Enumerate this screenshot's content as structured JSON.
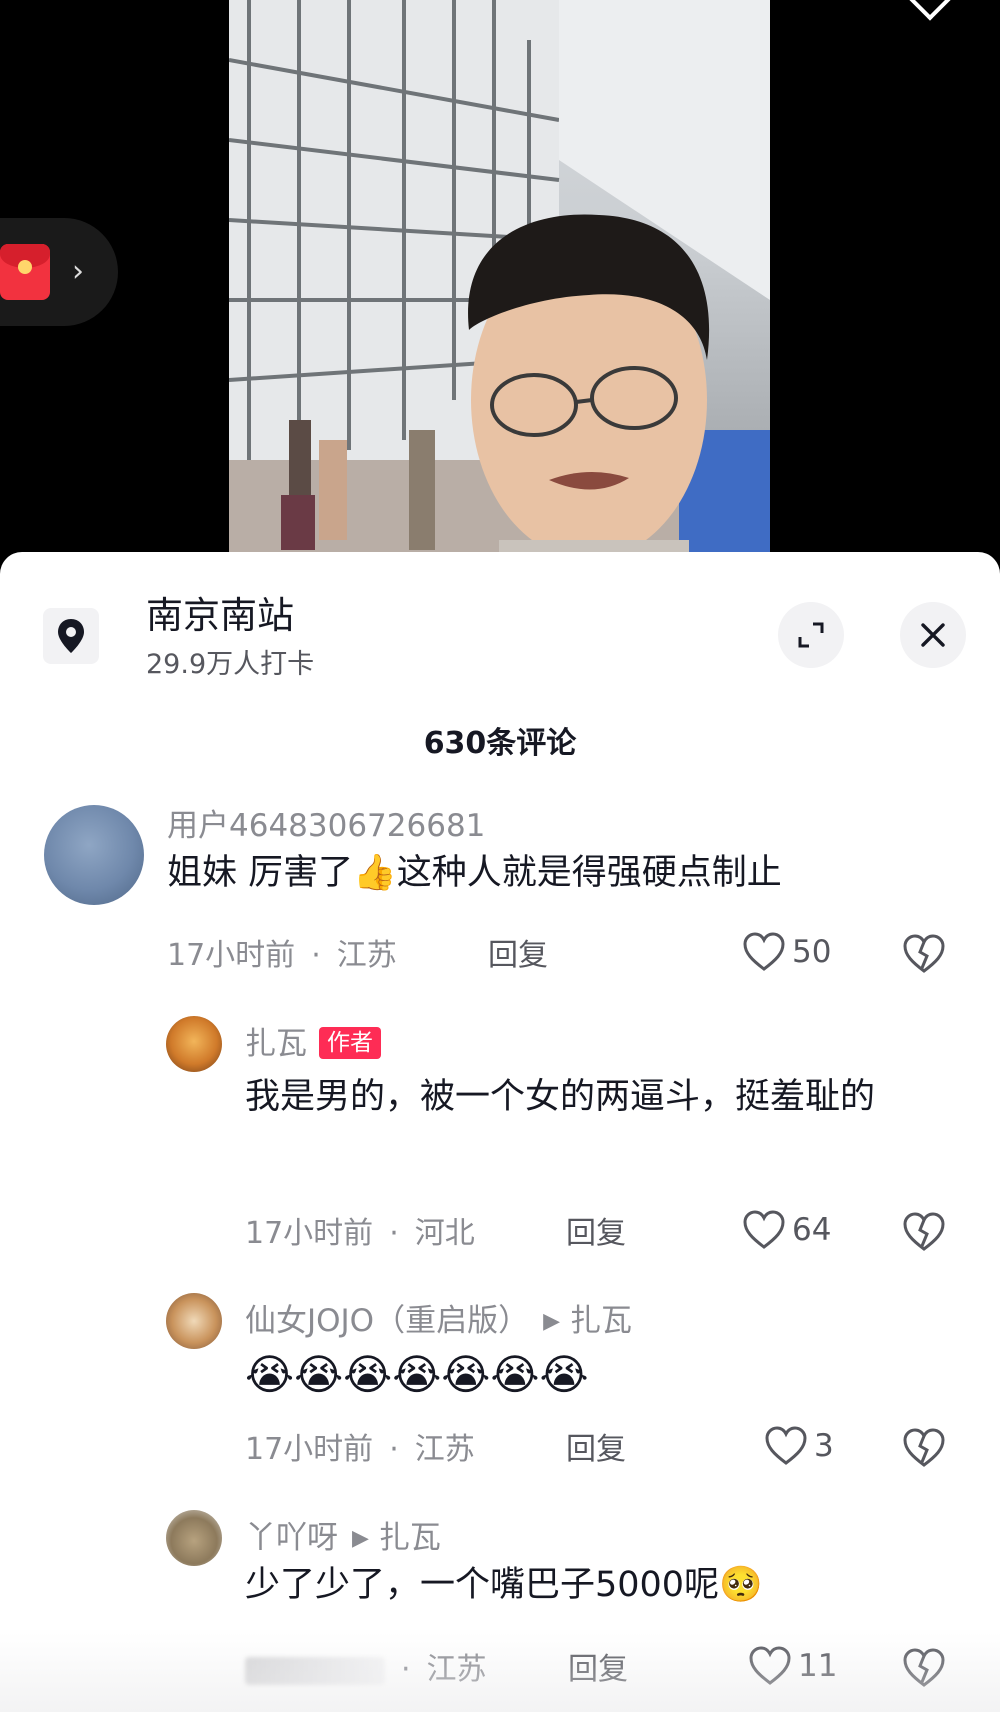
{
  "location": {
    "title": "南京南站",
    "checkins": "29.9万人打卡"
  },
  "comments_header": "630条评论",
  "comments": [
    {
      "username": "用户4648306726681",
      "text": "姐妹 厉害了👍这种人就是得强硬点制止",
      "time": "17小时前",
      "region": "江苏",
      "reply_label": "回复",
      "likes": "50"
    },
    {
      "username": "扎瓦",
      "badge": "作者",
      "text": "我是男的，被一个女的两逼斗，挺羞耻的",
      "time": "17小时前",
      "region": "河北",
      "reply_label": "回复",
      "likes": "64"
    },
    {
      "username": "仙女JOJO（重启版）",
      "reply_to": "扎瓦",
      "text": "😭😭😭😭😭😭😭",
      "time": "17小时前",
      "region": "江苏",
      "reply_label": "回复",
      "likes": "3"
    },
    {
      "username": "丫吖呀",
      "reply_to": "扎瓦",
      "text": "少了少了，一个嘴巴子5000呢🥺",
      "region": "江苏",
      "reply_label": "回复",
      "likes": "11"
    }
  ],
  "icons": {
    "location": "location-pin-icon",
    "expand": "expand-icon",
    "close": "close-icon",
    "like": "heart-outline-icon",
    "dislike": "broken-heart-icon",
    "red_packet": "red-packet-icon"
  },
  "colors": {
    "author_badge": "#fe2c55",
    "secondary_text": "#8a8b91",
    "primary_text": "#161823"
  }
}
